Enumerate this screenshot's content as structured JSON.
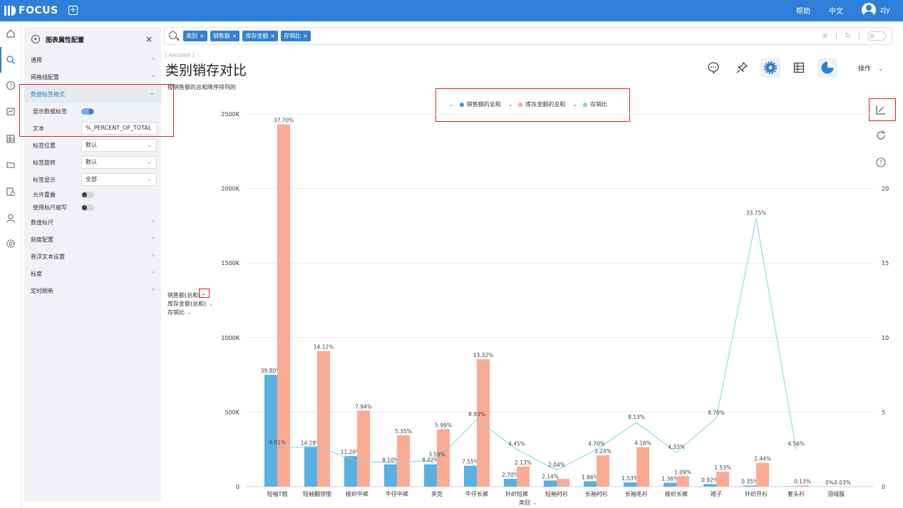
{
  "app": {
    "title": "FOCUS",
    "help": "帮助",
    "language": "中文",
    "user": "zjy"
  },
  "panel": {
    "title": "图表属性配置",
    "sections_top": [
      {
        "label": "通用"
      },
      {
        "label": "网格线配置"
      },
      {
        "label": "数据标签格式"
      }
    ],
    "data_label": {
      "show_label": "显示数据标签",
      "text_label": "文本",
      "text_value": "%_PERCENT_OF_TOTAL",
      "position_label": "标签位置",
      "position_value": "默认",
      "rotation_label": "标签旋转",
      "rotation_value": "默认",
      "display_label": "标签显示",
      "display_value": "全部",
      "overlap_label": "允许重叠",
      "scale_label": "使用标尺缩写"
    },
    "sections_bottom": [
      {
        "label": "数值标尺"
      },
      {
        "label": "刻度配置"
      },
      {
        "label": "悬浮文本设置"
      },
      {
        "label": "标度"
      },
      {
        "label": "定时刷新"
      }
    ]
  },
  "search": {
    "tags": [
      "类别",
      "销售额",
      "库存金额",
      "存销比"
    ]
  },
  "answer": {
    "tag": "[ ANSWER ]",
    "title": "类别销存对比",
    "subtitle": "按销售额的总和降序排列的",
    "ops": "操作"
  },
  "legend": [
    "销售额的总和",
    "库存金额的总和",
    "存销比"
  ],
  "y_axis_fields": [
    "销售额(总和)",
    "库存金额(总和)",
    "存销比"
  ],
  "x_axis_title": "类别",
  "colors": {
    "primary": "#2f7fd8",
    "sales": "#5aaee0",
    "inventory": "#fbab94",
    "ratio": "#7fd3df",
    "highlight": "#e02020"
  },
  "chart_data": {
    "type": "bar",
    "categories": [
      "短袖T恤",
      "短袖翻领恤",
      "梭织中裤",
      "牛仔中裤",
      "夹克",
      "牛仔长裤",
      "针织短裤",
      "短袖衬衫",
      "长袖衬衫",
      "长袖毛衫",
      "梭织长裤",
      "裙子",
      "针织开衫",
      "套头衫",
      "羽绒服"
    ],
    "series": [
      {
        "name": "销售额的总和",
        "axis": "left",
        "values": [
          750000,
          265000,
          205000,
          150000,
          150000,
          140000,
          52000,
          41000,
          36000,
          28000,
          26000,
          17000,
          7000,
          2500,
          0
        ],
        "labels": [
          "39.80%",
          "14.28%",
          "11.26%",
          "8.10%",
          "8.02%",
          "7.55%",
          "2.70%",
          "2.14%",
          "1.86%",
          "1.53%",
          "1.36%",
          "0.92%",
          "0.35%",
          "",
          "0%"
        ]
      },
      {
        "name": "库存金额的总和",
        "axis": "left",
        "values": [
          2430000,
          910000,
          510000,
          345000,
          385000,
          855000,
          135000,
          52000,
          210000,
          265000,
          70000,
          100000,
          160000,
          8000,
          1000
        ],
        "labels": [
          "37.70%",
          "14.12%",
          "7.94%",
          "5.35%",
          "5.99%",
          "13.32%",
          "2.13%",
          "",
          "3.24%",
          "4.16%",
          "1.09%",
          "1.53%",
          "2.44%",
          "0.13%",
          "0.03%"
        ]
      },
      {
        "name": "存销比",
        "axis": "right",
        "type": "line",
        "values": [
          2.6,
          2.7,
          1.7,
          1.6,
          1.8,
          4.5,
          2.5,
          1.1,
          2.5,
          4.3,
          2.3,
          4.6,
          18.0,
          2.5,
          null
        ],
        "labels": [
          "4.91%",
          "",
          "",
          "",
          "3.59%",
          "8.93%",
          "4.45%",
          "2.04%",
          "4.70%",
          "8.13%",
          "4.33%",
          "8.70%",
          "33.75%",
          "4.56%",
          ""
        ]
      }
    ],
    "y_left": {
      "ticks": [
        "0",
        "500K",
        "1000K",
        "1500K",
        "2000K",
        "2500K"
      ],
      "range": [
        0,
        2500000
      ]
    },
    "y_right": {
      "ticks": [
        "0",
        "5",
        "10",
        "15",
        "20"
      ],
      "range": [
        0,
        25
      ]
    },
    "xlabel": "类别",
    "grid": true,
    "legend_position": "top"
  }
}
